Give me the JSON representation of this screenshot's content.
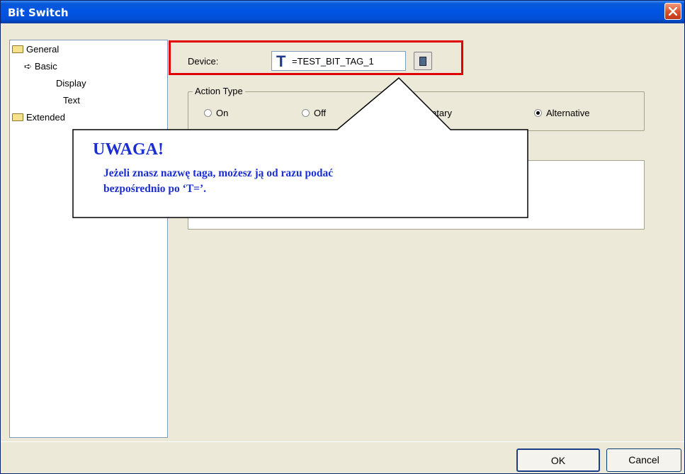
{
  "window": {
    "title": "Bit Switch"
  },
  "tree": {
    "items": [
      {
        "label": "General",
        "icon": "folder-icon"
      },
      {
        "label": "Basic",
        "icon": "arrow-right-icon"
      },
      {
        "label": "Display"
      },
      {
        "label": "Text"
      },
      {
        "label": "Extended",
        "icon": "folder-icon"
      }
    ]
  },
  "device": {
    "label": "Device:",
    "badge": "T",
    "value": "=TEST_BIT_TAG_1"
  },
  "action_type": {
    "title": "Action Type",
    "options": [
      {
        "label": "On",
        "selected": false
      },
      {
        "label": "Off",
        "selected": false
      },
      {
        "label": "Momentary",
        "visible_label": "mentary",
        "selected": false
      },
      {
        "label": "Alternative",
        "selected": true
      }
    ]
  },
  "callout": {
    "title": "UWAGA!",
    "line1": "Jeżeli znasz nazwę taga, możesz ją od razu podać",
    "line2": "bezpośrednio po ‘T=’."
  },
  "buttons": {
    "ok": "OK",
    "cancel": "Cancel"
  },
  "colors": {
    "titlebar": "#0054e3",
    "callout_text": "#1b2fd0",
    "highlight": "#e00000",
    "dialog_bg": "#ece9d8"
  }
}
